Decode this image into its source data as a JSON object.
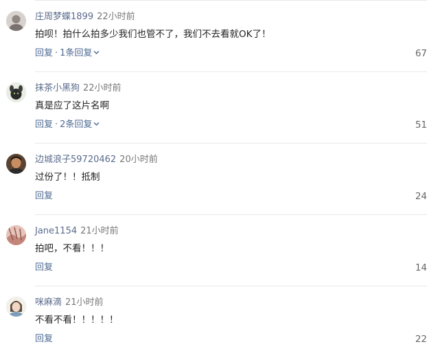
{
  "comments": [
    {
      "username": "庄周梦蝶1899",
      "time": "22小时前",
      "text": "拍呗！拍什么拍多少我们也管不了，我们不去看就OK了！",
      "reply_label": "回复",
      "reply_count_label": "1条回复",
      "likes": "67",
      "avatar_icon": "avatar-gray-portrait"
    },
    {
      "username": "抹茶小黑狗",
      "time": "22小时前",
      "text": "真是应了这片名啊",
      "reply_label": "回复",
      "reply_count_label": "2条回复",
      "likes": "51",
      "avatar_icon": "avatar-black-puppy"
    },
    {
      "username": "边城浪子59720462",
      "time": "20小时前",
      "text": "过份了！！抵制",
      "reply_label": "回复",
      "reply_count_label": "",
      "likes": "24",
      "avatar_icon": "avatar-man-portrait"
    },
    {
      "username": "Jane1154",
      "time": "21小时前",
      "text": "拍吧，不看！！！",
      "reply_label": "回复",
      "reply_count_label": "",
      "likes": "14",
      "avatar_icon": "avatar-pink-abstract"
    },
    {
      "username": "咪麻滴",
      "time": "21小时前",
      "text": "不看不看！！！！！",
      "reply_label": "回复",
      "reply_count_label": "",
      "likes": "22",
      "avatar_icon": "avatar-illustrated-girl"
    }
  ],
  "separator": "·"
}
